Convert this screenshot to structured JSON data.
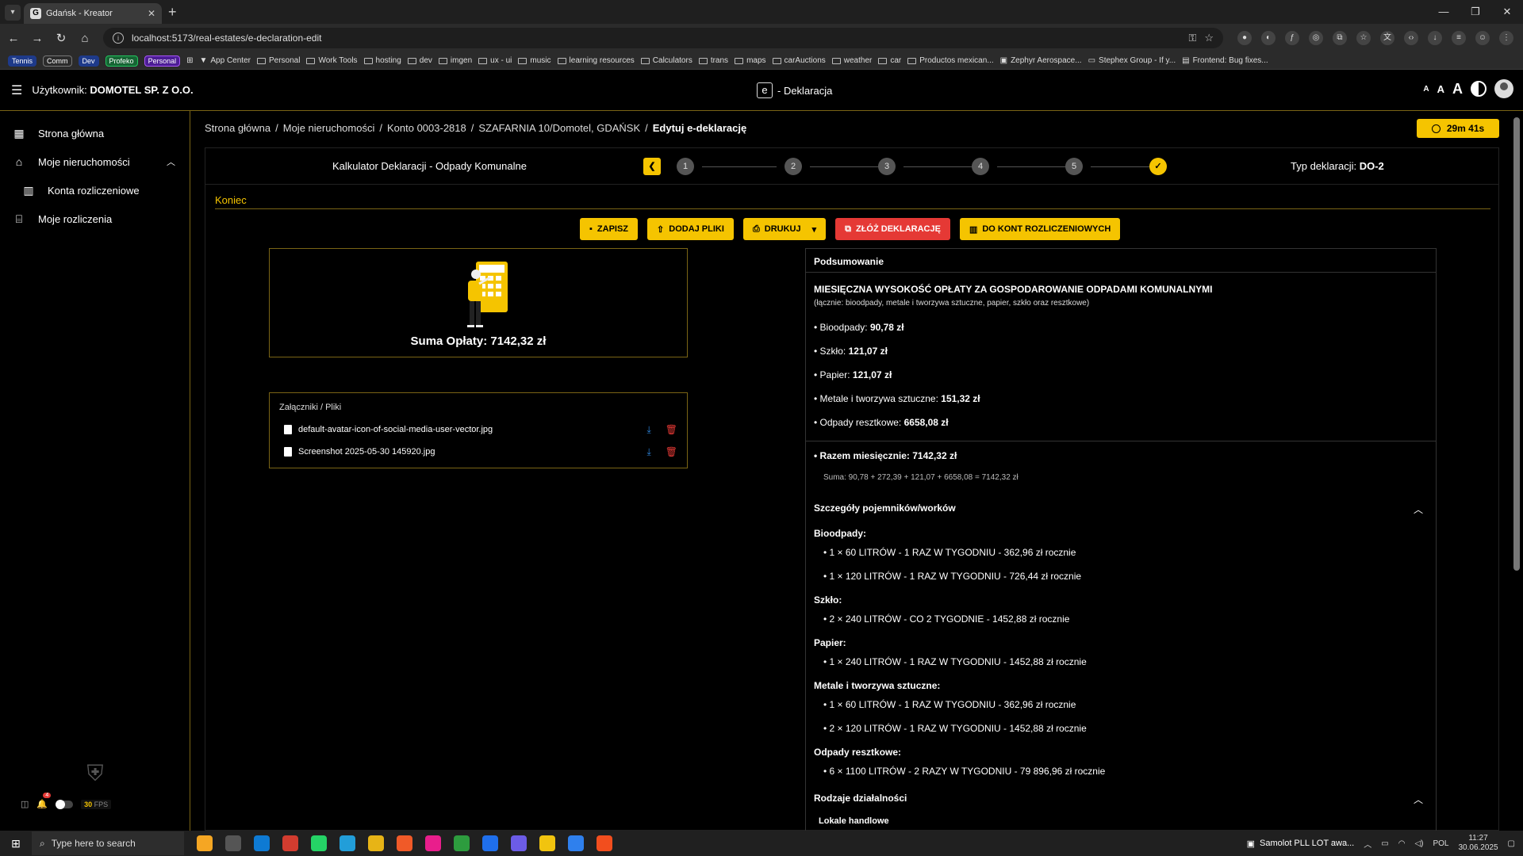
{
  "browser": {
    "tab_title": "Gdańsk - Kreator",
    "url": "localhost:5173/real-estates/e-declaration-edit",
    "bookmark_tags": [
      "Tennis",
      "Comm",
      "Dev",
      "Profeko",
      "Personal"
    ],
    "bookmarks": [
      "App Center",
      "Personal",
      "Work Tools",
      "hosting",
      "dev",
      "imgen",
      "ux - ui",
      "music",
      "learning resources",
      "Calculators",
      "trans",
      "maps",
      "carAuctions",
      "weather",
      "car",
      "Productos mexican...",
      "Zephyr Aerospace...",
      "Stephex Group - If y...",
      "Frontend: Bug fixes..."
    ]
  },
  "header": {
    "user_prefix": "Użytkownik:",
    "user_name": "DOMOTEL SP. Z O.O.",
    "logo_letter": "e",
    "app_title": "- Deklaracja",
    "font_sizes": [
      "A",
      "A",
      "A"
    ]
  },
  "sidebar": {
    "items": [
      {
        "label": "Strona główna",
        "icon": "dashboard-icon"
      },
      {
        "label": "Moje nieruchomości",
        "icon": "home-icon"
      },
      {
        "label": "Konta rozliczeniowe",
        "icon": "building-icon"
      },
      {
        "label": "Moje rozliczenia",
        "icon": "bank-icon"
      }
    ],
    "notif_count": "4",
    "fps_value": "30",
    "fps_label": "FPS"
  },
  "breadcrumb": {
    "items": [
      "Strona główna",
      "Moje nieruchomości",
      "Konto 0003-2818",
      "SZAFARNIA 10/Domotel, GDAŃSK"
    ],
    "current": "Edytuj e-deklarację"
  },
  "timer": "29m 41s",
  "stepper": {
    "title": "Kalkulator Deklaracji - Odpady Komunalne",
    "steps": [
      "1",
      "2",
      "3",
      "4",
      "5"
    ],
    "done_mark": "✓",
    "decl_type_label": "Typ deklaracji:",
    "decl_type_value": "DO-2"
  },
  "section_label": "Koniec",
  "actions": {
    "save": "ZAPISZ",
    "add_files": "DODAJ PLIKI",
    "print": "DRUKUJ",
    "submit": "ZŁÓŻ DEKLARACJĘ",
    "accounts": "DO KONT ROZLICZENIOWYCH"
  },
  "sum": {
    "text": "Suma Opłaty: 7142,32 zł"
  },
  "files": {
    "title": "Załączniki / Pliki",
    "items": [
      "default-avatar-icon-of-social-media-user-vector.jpg",
      "Screenshot 2025-05-30 145920.jpg"
    ]
  },
  "summary": {
    "head": "Podsumowanie",
    "title": "MIESIĘCZNA WYSOKOŚĆ OPŁATY ZA GOSPODAROWANIE ODPADAMI KOMUNALNYMI",
    "subtitle": "(łącznie: bioodpady, metale i tworzywa sztuczne, papier, szkło oraz resztkowe)",
    "items": [
      {
        "label": "• Bioodpady:",
        "value": "90,78 zł"
      },
      {
        "label": "• Szkło:",
        "value": "121,07 zł"
      },
      {
        "label": "• Papier:",
        "value": "121,07 zł"
      },
      {
        "label": "• Metale i tworzywa sztuczne:",
        "value": "151,32 zł"
      },
      {
        "label": "• Odpady resztkowe:",
        "value": "6658,08 zł"
      }
    ],
    "total_label": "• Razem miesięcznie: 7142,32 zł",
    "calc": "Suma: 90,78 + 272,39 + 121,07 + 6658,08 = 7142,32 zł",
    "containers_title": "Szczegóły pojemników/worków",
    "groups": [
      {
        "name": "Bioodpady:",
        "bins": [
          "• 1 × 60 LITRÓW - 1 RAZ W TYGODNIU - 362,96 zł rocznie",
          "• 1 × 120 LITRÓW - 1 RAZ W TYGODNIU - 726,44 zł rocznie"
        ]
      },
      {
        "name": "Szkło:",
        "bins": [
          "• 2 × 240 LITRÓW - CO 2 TYGODNIE - 1452,88 zł rocznie"
        ]
      },
      {
        "name": "Papier:",
        "bins": [
          "• 1 × 240 LITRÓW - 1 RAZ W TYGODNIU - 1452,88 zł rocznie"
        ]
      },
      {
        "name": "Metale i tworzywa sztuczne:",
        "bins": [
          "• 1 × 60 LITRÓW - 1 RAZ W TYGODNIU - 362,96 zł rocznie",
          "• 2 × 120 LITRÓW - 1 RAZ W TYGODNIU - 1452,88 zł rocznie"
        ]
      },
      {
        "name": "Odpady resztkowe:",
        "bins": [
          "• 6 × 1100 LITRÓW - 2 RAZY W TYGODNIU - 79 896,96 zł rocznie"
        ]
      }
    ],
    "activity_title": "Rodzaje działalności",
    "activity_item": "Lokale handlowe"
  },
  "taskbar": {
    "search_placeholder": "Type here to search",
    "task_label": "Samolot PLL LOT awa...",
    "lang": "POL",
    "time": "11:27",
    "date": "30.06.2025"
  }
}
